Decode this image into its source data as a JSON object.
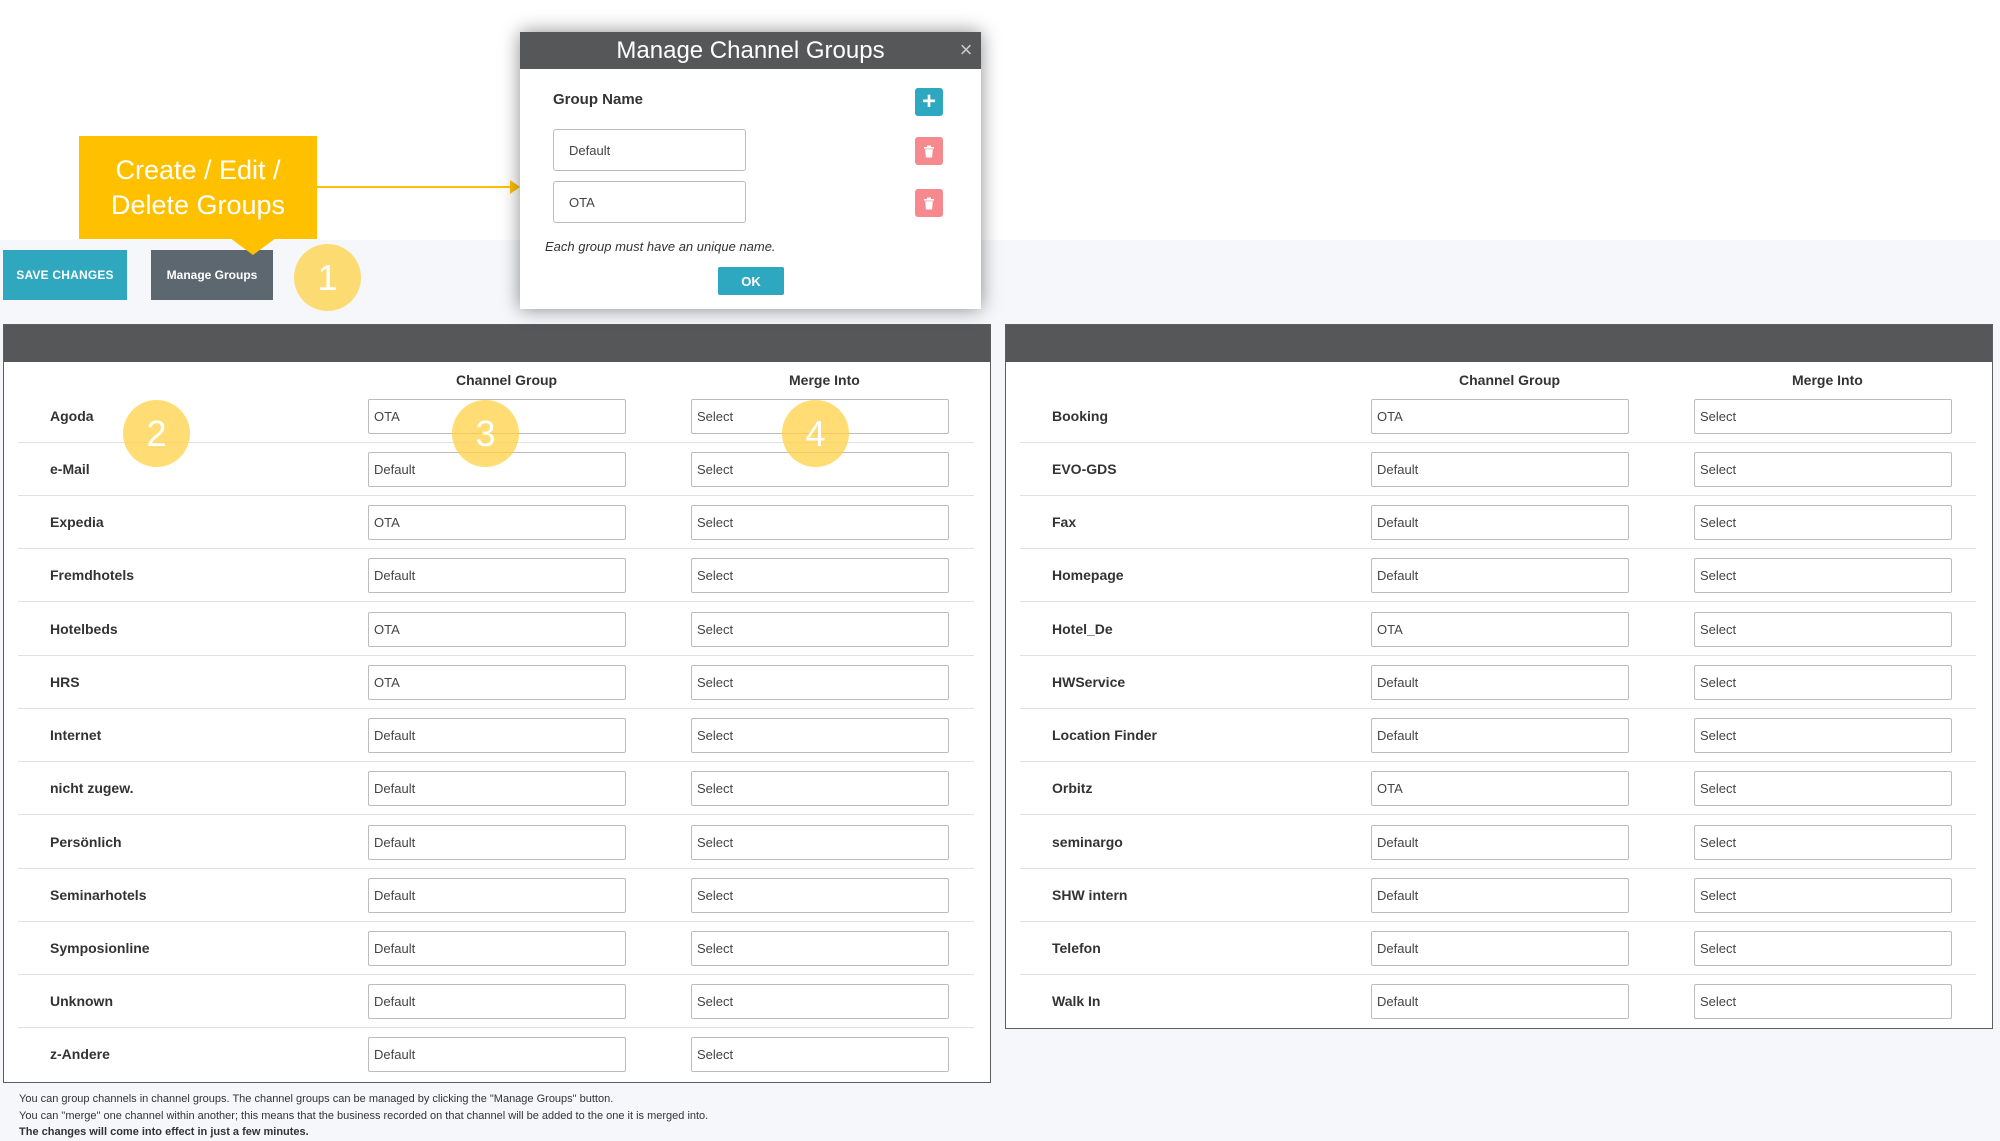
{
  "toolbar": {
    "save_label": "SAVE CHANGES",
    "manage_label": "Manage Groups"
  },
  "callout": {
    "text": "Create / Edit / Delete Groups",
    "color": "#ffc000"
  },
  "markers": [
    "1",
    "2",
    "3",
    "4"
  ],
  "columns": {
    "channel_group": "Channel Group",
    "merge_into": "Merge Into"
  },
  "left_rows": [
    {
      "channel": "Agoda",
      "group": "OTA",
      "merge": "Select"
    },
    {
      "channel": "e-Mail",
      "group": "Default",
      "merge": "Select"
    },
    {
      "channel": "Expedia",
      "group": "OTA",
      "merge": "Select"
    },
    {
      "channel": "Fremdhotels",
      "group": "Default",
      "merge": "Select"
    },
    {
      "channel": "Hotelbeds",
      "group": "OTA",
      "merge": "Select"
    },
    {
      "channel": "HRS",
      "group": "OTA",
      "merge": "Select"
    },
    {
      "channel": "Internet",
      "group": "Default",
      "merge": "Select"
    },
    {
      "channel": "nicht zugew.",
      "group": "Default",
      "merge": "Select"
    },
    {
      "channel": "Persönlich",
      "group": "Default",
      "merge": "Select"
    },
    {
      "channel": "Seminarhotels",
      "group": "Default",
      "merge": "Select"
    },
    {
      "channel": "Symposionline",
      "group": "Default",
      "merge": "Select"
    },
    {
      "channel": "Unknown",
      "group": "Default",
      "merge": "Select"
    },
    {
      "channel": "z-Andere",
      "group": "Default",
      "merge": "Select"
    }
  ],
  "right_rows": [
    {
      "channel": "Booking",
      "group": "OTA",
      "merge": "Select"
    },
    {
      "channel": "EVO-GDS",
      "group": "Default",
      "merge": "Select"
    },
    {
      "channel": "Fax",
      "group": "Default",
      "merge": "Select"
    },
    {
      "channel": "Homepage",
      "group": "Default",
      "merge": "Select"
    },
    {
      "channel": "Hotel_De",
      "group": "OTA",
      "merge": "Select"
    },
    {
      "channel": "HWService",
      "group": "Default",
      "merge": "Select"
    },
    {
      "channel": "Location Finder",
      "group": "Default",
      "merge": "Select"
    },
    {
      "channel": "Orbitz",
      "group": "OTA",
      "merge": "Select"
    },
    {
      "channel": "seminargo",
      "group": "Default",
      "merge": "Select"
    },
    {
      "channel": "SHW intern",
      "group": "Default",
      "merge": "Select"
    },
    {
      "channel": "Telefon",
      "group": "Default",
      "merge": "Select"
    },
    {
      "channel": "Walk In",
      "group": "Default",
      "merge": "Select"
    }
  ],
  "footer": {
    "line1": "You can group channels in channel groups. The channel groups can be managed by clicking the \"Manage Groups\" button.",
    "line2": "You can \"merge\" one channel within another; this means that the business recorded on that channel will be added to the one it is merged into.",
    "line3": "The changes will come into effect in just a few minutes."
  },
  "modal": {
    "title": "Manage Channel Groups",
    "close_icon": "×",
    "group_name_label": "Group Name",
    "add_icon": "+",
    "groups": [
      "Default",
      "OTA"
    ],
    "note": "Each group must have an unique name.",
    "ok_label": "OK"
  },
  "colors": {
    "accent": "#2fa7bf",
    "header": "#555759",
    "delete": "#f5898d",
    "marker": "#ffd246"
  }
}
